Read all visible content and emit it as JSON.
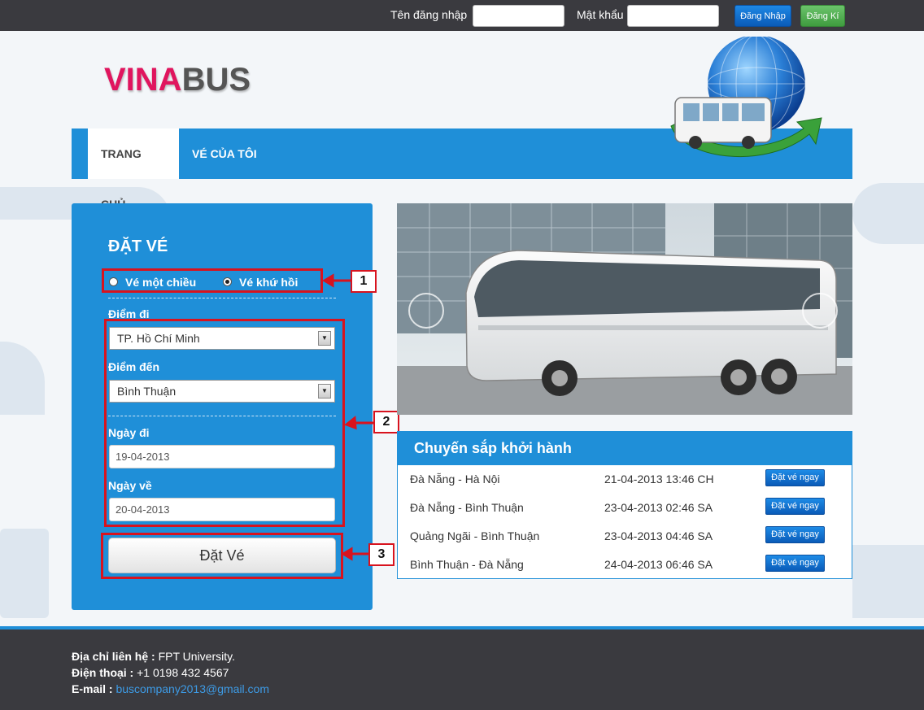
{
  "topbar": {
    "username_label": "Tên đăng nhập",
    "password_label": "Mật khẩu",
    "username_value": "",
    "password_value": "",
    "login_button": "Đăng Nhập",
    "register_button": "Đăng Kí"
  },
  "brand": {
    "part1": "VINA",
    "part2": "BUS"
  },
  "nav": {
    "tabs": [
      {
        "label": "TRANG CHỦ",
        "active": true
      },
      {
        "label": "VÉ CỦA TÔI",
        "active": false
      }
    ]
  },
  "booking": {
    "title": "ĐẶT VÉ",
    "trip_type_options": [
      {
        "label": "Vé một chiều",
        "selected": false
      },
      {
        "label": "Vé khứ hồi",
        "selected": true
      }
    ],
    "from_label": "Điểm đi",
    "from_value": "TP. Hồ Chí Minh",
    "to_label": "Điểm đến",
    "to_value": "Bình Thuận",
    "depart_label": "Ngày đi",
    "depart_value": "19-04-2013",
    "return_label": "Ngày về",
    "return_value": "20-04-2013",
    "submit_label": "Đặt Vé"
  },
  "callouts": [
    "1",
    "2",
    "3"
  ],
  "upcoming": {
    "title": "Chuyến sắp khởi hành",
    "button_label": "Đặt vé ngay",
    "trips": [
      {
        "route": "Đà Nẵng - Hà Nội",
        "time": "21-04-2013 13:46 CH"
      },
      {
        "route": "Đà Nẵng - Bình Thuận",
        "time": "23-04-2013 02:46 SA"
      },
      {
        "route": "Quảng Ngãi - Bình Thuận",
        "time": "23-04-2013 04:46 SA"
      },
      {
        "route": "Bình Thuận - Đà Nẵng",
        "time": "24-04-2013 06:46 SA"
      }
    ]
  },
  "footer": {
    "address_label": "Địa chỉ liên hệ :",
    "address_value": "FPT University.",
    "phone_label": "Điện thoại :",
    "phone_value": "+1 0198 432 4567",
    "email_label": "E-mail :",
    "email_value": "buscompany2013@gmail.com"
  },
  "colors": {
    "accent": "#1f8fd8",
    "brand_red": "#e0155e",
    "annotation_red": "#d8131e",
    "dark_bar": "#3a3a3f"
  },
  "icons": [
    "globe-bus-logo",
    "bus-photo",
    "slideshow-prev-icon",
    "slideshow-next-icon",
    "callout-arrow-icon"
  ]
}
